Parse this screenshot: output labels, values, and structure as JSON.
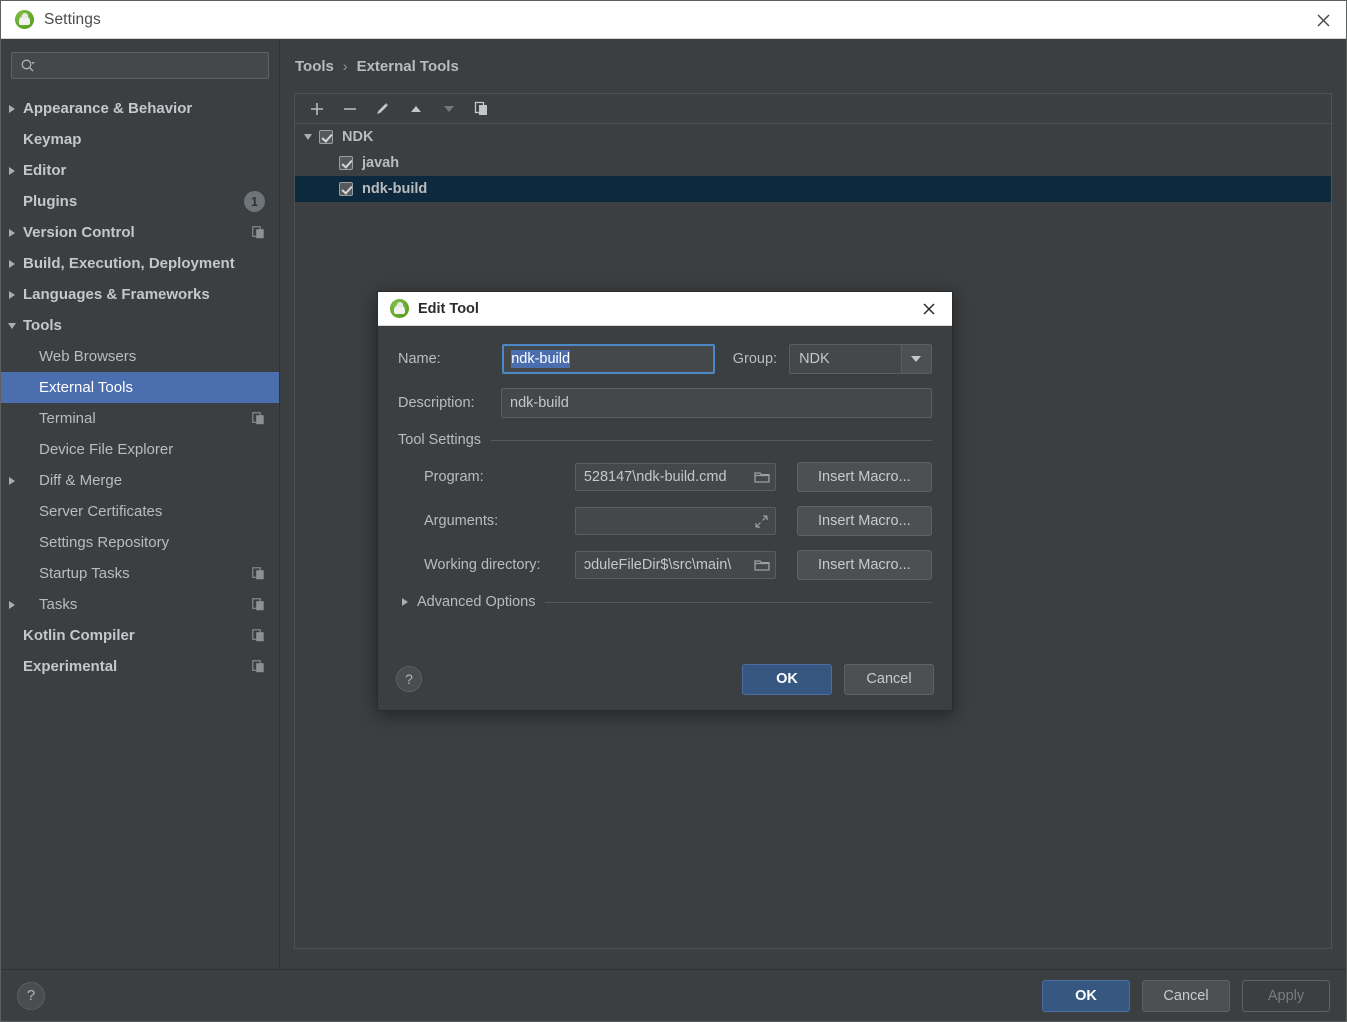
{
  "window": {
    "title": "Settings",
    "app_icon": "android-icon",
    "close_icon": "close-icon"
  },
  "sidebar": {
    "search": {
      "placeholder": "",
      "value": "",
      "icon": "search-icon"
    },
    "items": [
      {
        "label": "Appearance & Behavior",
        "arrow": "right",
        "indent": 0,
        "bold": true,
        "badge": null,
        "copy": false
      },
      {
        "label": "Keymap",
        "arrow": "none",
        "indent": 0,
        "bold": true,
        "badge": null,
        "copy": false
      },
      {
        "label": "Editor",
        "arrow": "right",
        "indent": 0,
        "bold": true,
        "badge": null,
        "copy": false
      },
      {
        "label": "Plugins",
        "arrow": "none",
        "indent": 0,
        "bold": true,
        "badge": "1",
        "copy": false
      },
      {
        "label": "Version Control",
        "arrow": "right",
        "indent": 0,
        "bold": true,
        "badge": null,
        "copy": true
      },
      {
        "label": "Build, Execution, Deployment",
        "arrow": "right",
        "indent": 0,
        "bold": true,
        "badge": null,
        "copy": false
      },
      {
        "label": "Languages & Frameworks",
        "arrow": "right",
        "indent": 0,
        "bold": true,
        "badge": null,
        "copy": false
      },
      {
        "label": "Tools",
        "arrow": "down",
        "indent": 0,
        "bold": true,
        "badge": null,
        "copy": false
      },
      {
        "label": "Web Browsers",
        "arrow": "none",
        "indent": 1,
        "bold": false,
        "badge": null,
        "copy": false
      },
      {
        "label": "External Tools",
        "arrow": "none",
        "indent": 1,
        "bold": false,
        "badge": null,
        "copy": false,
        "selected": true
      },
      {
        "label": "Terminal",
        "arrow": "none",
        "indent": 1,
        "bold": false,
        "badge": null,
        "copy": true
      },
      {
        "label": "Device File Explorer",
        "arrow": "none",
        "indent": 1,
        "bold": false,
        "badge": null,
        "copy": false
      },
      {
        "label": "Diff & Merge",
        "arrow": "right",
        "indent": 1,
        "bold": false,
        "badge": null,
        "copy": false
      },
      {
        "label": "Server Certificates",
        "arrow": "none",
        "indent": 1,
        "bold": false,
        "badge": null,
        "copy": false
      },
      {
        "label": "Settings Repository",
        "arrow": "none",
        "indent": 1,
        "bold": false,
        "badge": null,
        "copy": false
      },
      {
        "label": "Startup Tasks",
        "arrow": "none",
        "indent": 1,
        "bold": false,
        "badge": null,
        "copy": true
      },
      {
        "label": "Tasks",
        "arrow": "right",
        "indent": 1,
        "bold": false,
        "badge": null,
        "copy": true
      },
      {
        "label": "Kotlin Compiler",
        "arrow": "none",
        "indent": 0,
        "bold": true,
        "badge": null,
        "copy": true
      },
      {
        "label": "Experimental",
        "arrow": "none",
        "indent": 0,
        "bold": true,
        "badge": null,
        "copy": true
      }
    ]
  },
  "main": {
    "breadcrumb": {
      "parent": "Tools",
      "separator": "›",
      "current": "External Tools"
    },
    "toolbar": [
      {
        "name": "add-button",
        "icon": "plus-icon",
        "enabled": true
      },
      {
        "name": "remove-button",
        "icon": "minus-icon",
        "enabled": true
      },
      {
        "name": "edit-button",
        "icon": "pencil-icon",
        "enabled": true
      },
      {
        "name": "move-up-button",
        "icon": "arrow-up-icon",
        "enabled": true
      },
      {
        "name": "move-down-button",
        "icon": "arrow-down-icon",
        "enabled": false
      },
      {
        "name": "copy-button",
        "icon": "copy-icon",
        "enabled": true
      }
    ],
    "tools": [
      {
        "label": "NDK",
        "level": 0,
        "checked": true,
        "expanded": true,
        "selected": false
      },
      {
        "label": "javah",
        "level": 1,
        "checked": true,
        "expanded": null,
        "selected": false
      },
      {
        "label": "ndk-build",
        "level": 1,
        "checked": true,
        "expanded": null,
        "selected": true
      }
    ]
  },
  "footer": {
    "help_icon": "question-mark-icon",
    "ok_label": "OK",
    "cancel_label": "Cancel",
    "apply_label": "Apply",
    "apply_enabled": false
  },
  "dialog": {
    "title": "Edit Tool",
    "app_icon": "android-icon",
    "close_icon": "close-icon",
    "name_label": "Name:",
    "name_value": "ndk-build",
    "group_label": "Group:",
    "group_value": "NDK",
    "description_label": "Description:",
    "description_value": "ndk-build",
    "tool_settings_title": "Tool Settings",
    "program_label": "Program:",
    "program_value": "528147\\ndk-build.cmd",
    "program_macro_label": "Insert Macro...",
    "arguments_label": "Arguments:",
    "arguments_value": "",
    "arguments_macro_label": "Insert Macro...",
    "working_dir_label": "Working directory:",
    "working_dir_value": "ɔduleFileDir$\\src\\main\\",
    "working_dir_macro_label": "Insert Macro...",
    "advanced_options_label": "Advanced Options",
    "help_icon": "question-mark-icon",
    "ok_label": "OK",
    "cancel_label": "Cancel"
  },
  "colors": {
    "background": "#3c3f41",
    "sidebar_selection": "#4b6eaf",
    "list_selection": "#0d293e",
    "primary_button": "#365880",
    "focus_border": "#4a88c7",
    "text": "#bbbbbb"
  }
}
